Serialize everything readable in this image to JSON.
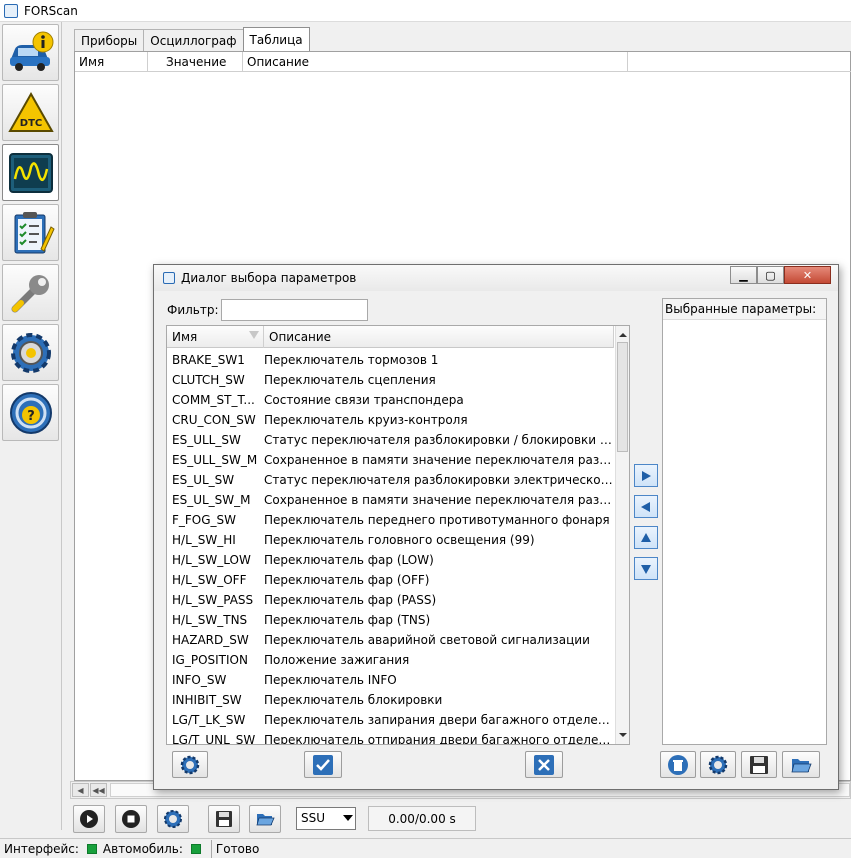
{
  "app": {
    "title": "FORScan"
  },
  "sidebar": {
    "items": [
      {
        "icon": "car-info-icon",
        "active": false
      },
      {
        "icon": "dtc-warning-icon",
        "active": false
      },
      {
        "icon": "oscilloscope-icon",
        "active": true
      },
      {
        "icon": "checklist-icon",
        "active": false
      },
      {
        "icon": "wrench-icon",
        "active": false
      },
      {
        "icon": "gear-icon",
        "active": false
      },
      {
        "icon": "help-steering-icon",
        "active": false
      }
    ]
  },
  "tabs": [
    {
      "label": "Приборы"
    },
    {
      "label": "Осциллограф"
    },
    {
      "label": "Таблица"
    }
  ],
  "table": {
    "columns": [
      "Имя",
      "Значение",
      "Описание"
    ]
  },
  "toolbar": {
    "select_value": "SSU",
    "time": "0.00/0.00 s"
  },
  "status": {
    "interface_label": "Интерфейс:",
    "vehicle_label": "Автомобиль:",
    "state": "Готово",
    "led_color": "#18a03c"
  },
  "dialog": {
    "title": "Диалог выбора параметров",
    "filter_label": "Фильтр:",
    "filter_value": "",
    "list_columns": [
      "Имя",
      "Описание"
    ],
    "selected_header": "Выбранные параметры:",
    "rows": [
      {
        "name": "BRAKE_SW1",
        "desc": "Переключатель тормозов 1"
      },
      {
        "name": "CLUTCH_SW",
        "desc": "Переключатель сцепления"
      },
      {
        "name": "COMM_ST_T...",
        "desc": "Состояние связи транспондера"
      },
      {
        "name": "CRU_CON_SW",
        "desc": "Переключатель круиз-контроля"
      },
      {
        "name": "ES_ULL_SW",
        "desc": "Статус переключателя разблокировки / блокировки эле..."
      },
      {
        "name": "ES_ULL_SW_M",
        "desc": "Сохраненное в памяти значение переключателя разбло..."
      },
      {
        "name": "ES_UL_SW",
        "desc": "Статус переключателя разблокировки электрического р..."
      },
      {
        "name": "ES_UL_SW_M",
        "desc": "Сохраненное в памяти значение переключателя разбло..."
      },
      {
        "name": "F_FOG_SW",
        "desc": "Переключатель переднего противотуманного фонаря"
      },
      {
        "name": "H/L_SW_HI",
        "desc": "Переключатель головного освещения (99)"
      },
      {
        "name": "H/L_SW_LOW",
        "desc": "Переключатель фар (LOW)"
      },
      {
        "name": "H/L_SW_OFF",
        "desc": "Переключатель фар (OFF)"
      },
      {
        "name": "H/L_SW_PASS",
        "desc": "Переключатель фар (PASS)"
      },
      {
        "name": "H/L_SW_TNS",
        "desc": "Переключатель фар (TNS)"
      },
      {
        "name": "HAZARD_SW",
        "desc": "Переключатель аварийной световой сигнализации"
      },
      {
        "name": "IG_POSITION",
        "desc": "Положение зажигания"
      },
      {
        "name": "INFO_SW",
        "desc": "Переключатель INFO"
      },
      {
        "name": "INHIBIT_SW",
        "desc": "Переключатель блокировки"
      },
      {
        "name": "LG/T_LK_SW",
        "desc": "Переключатель запирания двери багажного отделения/..."
      },
      {
        "name": "LG/T_UNL_SW",
        "desc": "Переключатель отпирания двери багажного отделения..."
      }
    ]
  }
}
